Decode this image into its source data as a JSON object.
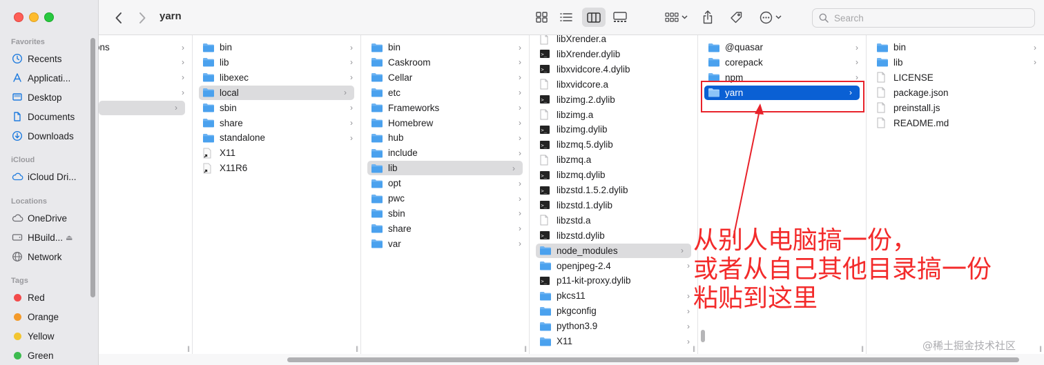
{
  "window": {
    "title": "yarn"
  },
  "toolbar": {
    "search_placeholder": "Search"
  },
  "sidebar": {
    "favorites_label": "Favorites",
    "favorites": [
      {
        "label": "Recents",
        "icon": "clock-icon"
      },
      {
        "label": "Applicati...",
        "icon": "applications-icon"
      },
      {
        "label": "Desktop",
        "icon": "desktop-icon"
      },
      {
        "label": "Documents",
        "icon": "document-icon"
      },
      {
        "label": "Downloads",
        "icon": "download-icon"
      }
    ],
    "icloud_label": "iCloud",
    "icloud": [
      {
        "label": "iCloud Dri...",
        "icon": "cloud-icon"
      }
    ],
    "locations_label": "Locations",
    "locations": [
      {
        "label": "OneDrive",
        "icon": "cloud-icon"
      },
      {
        "label": "HBuild...",
        "icon": "disk-icon"
      },
      {
        "label": "Network",
        "icon": "network-icon"
      }
    ],
    "tags_label": "Tags",
    "tags": [
      {
        "label": "Red",
        "color": "#f34b4b"
      },
      {
        "label": "Orange",
        "color": "#f39a2b"
      },
      {
        "label": "Yellow",
        "color": "#f2c531"
      },
      {
        "label": "Green",
        "color": "#3dbb4f"
      }
    ]
  },
  "columns": {
    "col0": [
      "ons"
    ],
    "col1": [
      "bin",
      "lib",
      "libexec",
      "local",
      "sbin",
      "share",
      "standalone",
      "X11",
      "X11R6"
    ],
    "col2": [
      "bin",
      "Caskroom",
      "Cellar",
      "etc",
      "Frameworks",
      "Homebrew",
      "hub",
      "include",
      "lib",
      "opt",
      "pwc",
      "sbin",
      "share",
      "var"
    ],
    "col3": [
      "libXrender.a",
      "libXrender.dylib",
      "libxvidcore.4.dylib",
      "libxvidcore.a",
      "libzimg.2.dylib",
      "libzimg.a",
      "libzimg.dylib",
      "libzmq.5.dylib",
      "libzmq.a",
      "libzmq.dylib",
      "libzstd.1.5.2.dylib",
      "libzstd.1.dylib",
      "libzstd.a",
      "libzstd.dylib",
      "node_modules",
      "openjpeg-2.4",
      "p11-kit-proxy.dylib",
      "pkcs11",
      "pkgconfig",
      "python3.9",
      "X11"
    ],
    "col4": [
      "@quasar",
      "corepack",
      "npm",
      "yarn"
    ],
    "col5": [
      "bin",
      "lib",
      "LICENSE",
      "package.json",
      "preinstall.js",
      "README.md"
    ]
  },
  "annotation": {
    "line1": "从别人电脑搞一份，",
    "line2": "或者从自己其他目录搞一份",
    "line3": "粘贴到这里",
    "color": "#f32b2b"
  },
  "watermark": "@稀土掘金技术社区"
}
